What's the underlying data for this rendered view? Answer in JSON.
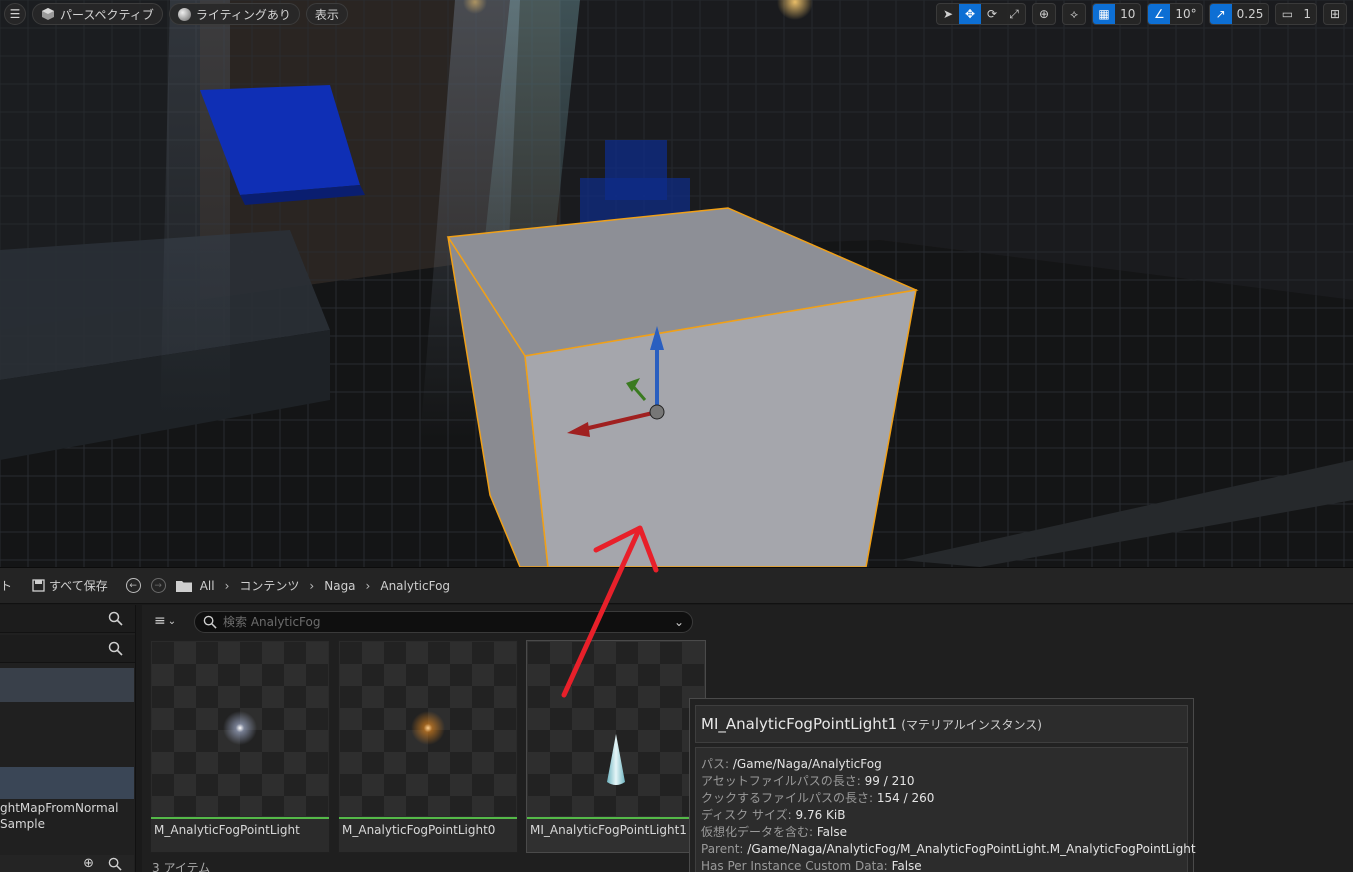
{
  "viewport": {
    "menu_icon": "hamburger-icon",
    "perspective_label": "パースペクティブ",
    "lighting_label": "ライティングあり",
    "show_label": "表示",
    "grid_snap_value": "10",
    "rotation_snap_value": "10°",
    "scale_snap_value": "0.25",
    "camera_speed_value": "1",
    "accent_color": "#0d6fd4",
    "selection_outline_color": "#f0a018"
  },
  "content_browser": {
    "topbar": {
      "cut_text": "ト",
      "save_all_label": "すべて保存",
      "breadcrumbs": [
        "All",
        "コンテンツ",
        "Naga",
        "AnalyticFog"
      ]
    },
    "left_panel": {
      "partial_items": [
        "ghtMapFromNormal",
        "Sample"
      ]
    },
    "search": {
      "placeholder": "検索 AnalyticFog"
    },
    "assets": [
      {
        "name": "M_AnalyticFogPointLight",
        "thumb_color": "#cfd8ff"
      },
      {
        "name": "M_AnalyticFogPointLight0",
        "thumb_color": "#ffa030"
      },
      {
        "name": "MI_AnalyticFogPointLight1",
        "thumb_color": "#bfe6ee"
      }
    ],
    "item_count": "3 アイテム",
    "bar_color": "#54b948"
  },
  "tooltip": {
    "title": "MI_AnalyticFogPointLight1",
    "kind": "(マテリアルインスタンス)",
    "rows": [
      {
        "key": "パス:",
        "value": "/Game/Naga/AnalyticFog"
      },
      {
        "key": "アセットファイルパスの長さ:",
        "value": "99 / 210"
      },
      {
        "key": "クックするファイルパスの長さ:",
        "value": "154 / 260"
      },
      {
        "key": "ディスク サイズ:",
        "value": "9.76 KiB"
      },
      {
        "key": "仮想化データを含む:",
        "value": "False"
      },
      {
        "key": "Parent:",
        "value": "/Game/Naga/AnalyticFog/M_AnalyticFogPointLight.M_AnalyticFogPointLight"
      },
      {
        "key": "Has Per Instance Custom Data:",
        "value": "False"
      }
    ]
  },
  "annotation": {
    "arrow_color": "#e8202a"
  }
}
